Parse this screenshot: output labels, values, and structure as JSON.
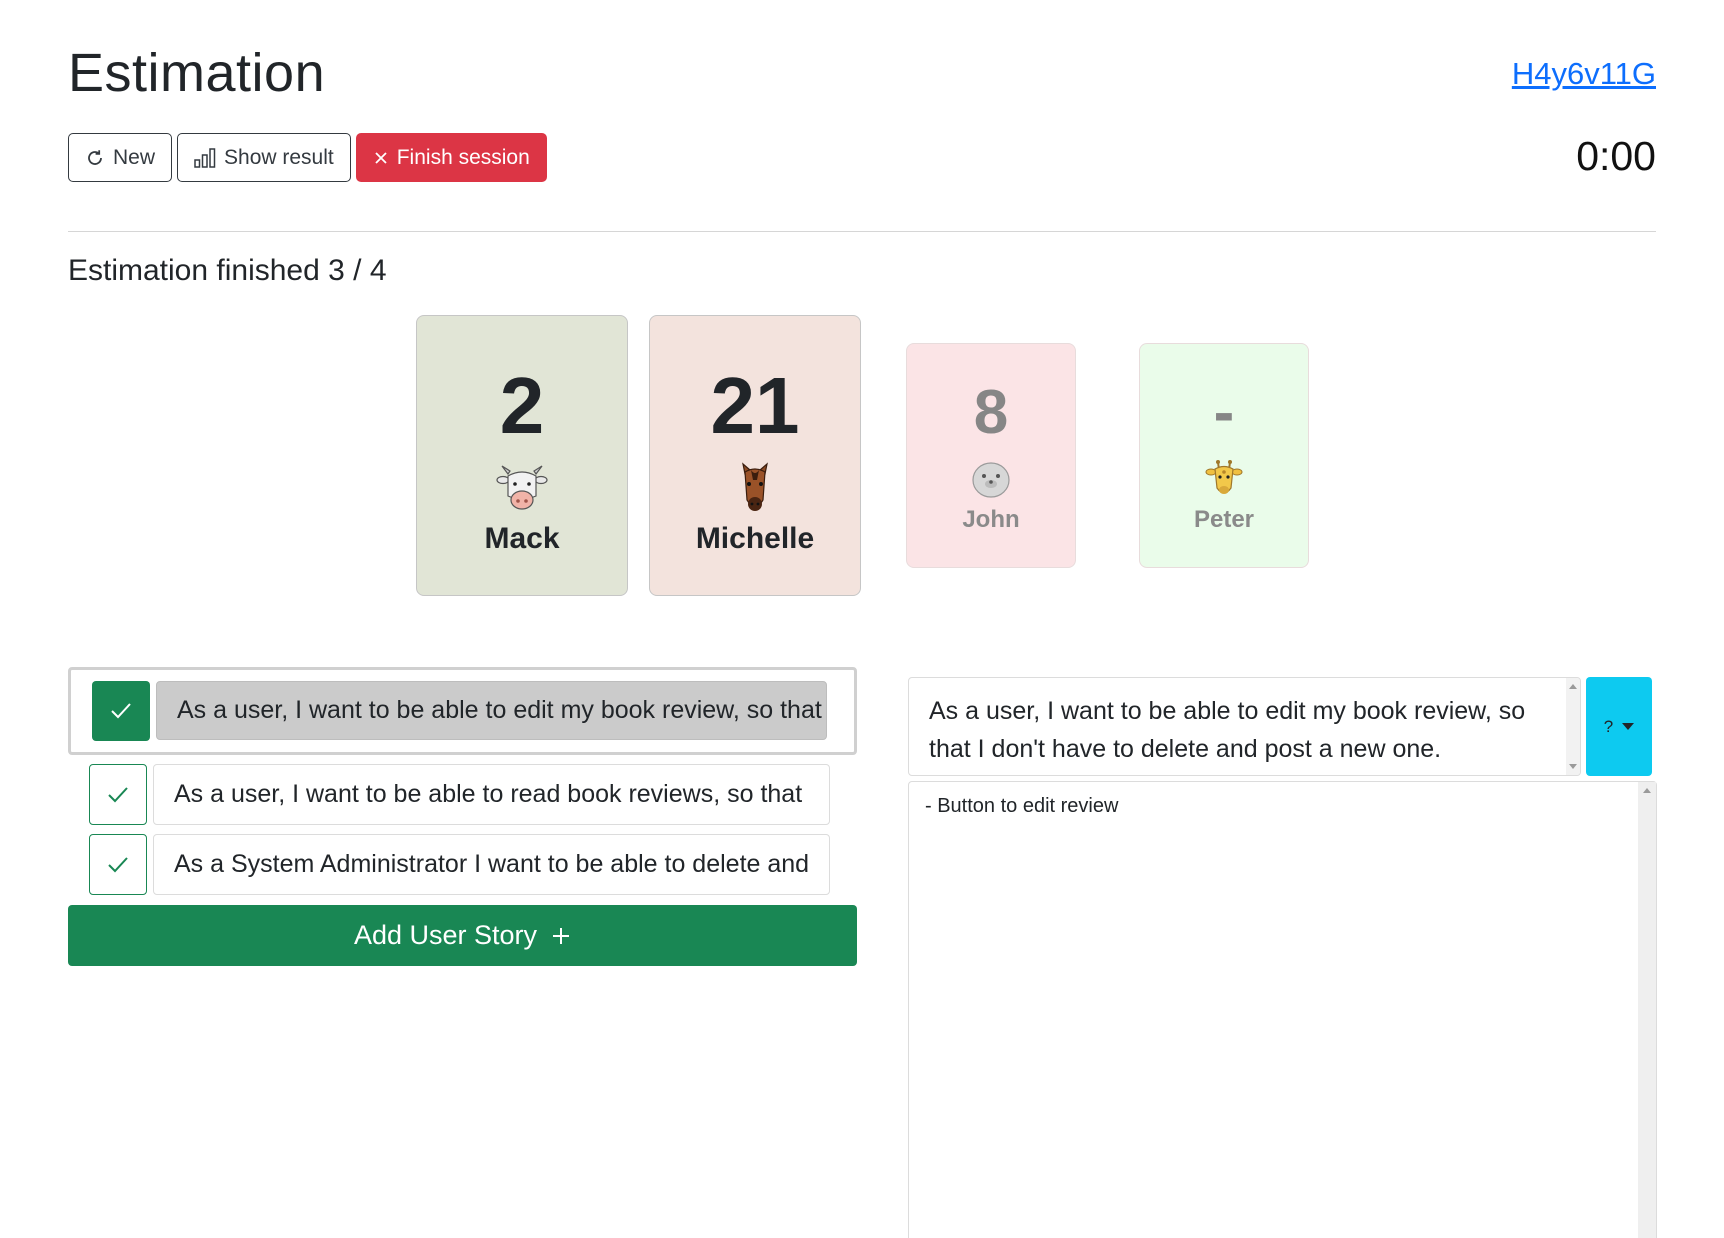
{
  "header": {
    "title": "Estimation",
    "session_code": "H4y6v11G",
    "timer": "0:00"
  },
  "toolbar": {
    "new_label": "New",
    "show_result_label": "Show result",
    "finish_label": "Finish session"
  },
  "status": {
    "text": "Estimation finished 3 / 4"
  },
  "participants": [
    {
      "name": "Mack",
      "value": "2",
      "animal": "cow-icon",
      "card_color": "#e1e5d6"
    },
    {
      "name": "Michelle",
      "value": "21",
      "animal": "horse-icon",
      "card_color": "#f3e3dd"
    },
    {
      "name": "John",
      "value": "8",
      "animal": "seal-icon",
      "card_color": "#fbe4e6"
    },
    {
      "name": "Peter",
      "value": "-",
      "animal": "giraffe-icon",
      "card_color": "#eafcea"
    }
  ],
  "stories": [
    {
      "text": "As a user, I want to be able to edit my book review, so that I don't have to delete and post a new one.",
      "done": true,
      "active": true
    },
    {
      "text": "As a user, I want to be able to read book reviews, so that",
      "done": true,
      "active": false
    },
    {
      "text": "As a System Administrator I want to be able to delete and",
      "done": true,
      "active": false
    }
  ],
  "add_story_label": "Add User Story",
  "detail": {
    "title": "As a user, I want to be able to edit my book review, so that I don't have to delete and post a new one.",
    "estimate": "?",
    "notes": "- Button to edit review"
  },
  "colors": {
    "primary_link": "#0d6efd",
    "danger": "#dc3545",
    "success": "#198754",
    "info": "#0dcaf0"
  }
}
